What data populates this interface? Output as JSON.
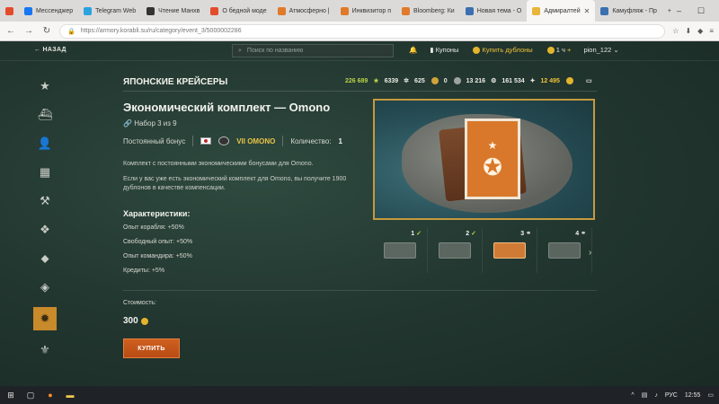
{
  "browser": {
    "tabs": [
      {
        "label": "Мессенджер",
        "color": "#1877f2"
      },
      {
        "label": "Telegram Web",
        "color": "#2aa3df"
      },
      {
        "label": "Чтение Манхв",
        "color": "#333333"
      },
      {
        "label": "О бедной моде",
        "color": "#e44b2a"
      },
      {
        "label": "Атмосферно |",
        "color": "#e07a2a"
      },
      {
        "label": "Инквизитор  п",
        "color": "#e07a2a"
      },
      {
        "label": "Bloomberg: Ки",
        "color": "#e07a2a"
      },
      {
        "label": "Новая тема - О",
        "color": "#3a6fb0"
      },
      {
        "label": "Адмиралтей",
        "color": "#e8b53a",
        "active": true
      },
      {
        "label": "Камуфляж - Пр",
        "color": "#3a6fb0"
      }
    ],
    "url": "https://armory.korabli.su/ru/category/event_3/5000002286"
  },
  "topbar": {
    "back_label": "НАЗАД",
    "search_placeholder": "Поиск по названию",
    "coupons_label": "Купоны",
    "buy_doubloons_label": "Купить дублоны",
    "timer": "1 ч",
    "username": "pion_122"
  },
  "category_title": "ЯПОНСКИЕ КРЕЙСЕРЫ",
  "resources": [
    {
      "value": "226 689",
      "kind": "free-xp",
      "color": "#b8d24a"
    },
    {
      "value": "6339",
      "kind": "elite-xp",
      "color": "#ecece6"
    },
    {
      "value": "625",
      "kind": "coal",
      "color": "#ecece6"
    },
    {
      "value": "0",
      "kind": "steel",
      "color": "#ecece6"
    },
    {
      "value": "13 216",
      "kind": "research",
      "color": "#ecece6"
    },
    {
      "value": "161 534",
      "kind": "credits",
      "color": "#ecece6"
    },
    {
      "value": "12 495",
      "kind": "doubloons",
      "color": "#f0c23a"
    }
  ],
  "product": {
    "title": "Экономический комплект — Omono",
    "set_info": "Набор 3 из 9",
    "bonus_type": "Постоянный бонус",
    "ship_tier": "VII OMONO",
    "quantity_label": "Количество:",
    "quantity_value": "1",
    "desc1": "Комплект с постоянными экономическими бонусами для Omono.",
    "desc2": "Если у вас уже есть экономический комплект для Omono, вы получите 1900 дублонов в качестве компенсации.",
    "chars_title": "Характеристики:",
    "characteristics": [
      "Опыт корабля: +50%",
      "Свободный опыт: +50%",
      "Опыт командира: +50%",
      "Кредиты: +5%"
    ],
    "cost_label": "Стоимость:",
    "cost_value": "300",
    "buy_label": "КУПИТЬ"
  },
  "set_items": [
    {
      "num": "1",
      "state": "owned"
    },
    {
      "num": "2",
      "state": "owned"
    },
    {
      "num": "3",
      "state": "current"
    },
    {
      "num": "4",
      "state": "linked"
    }
  ],
  "taskbar": {
    "lang": "РУС",
    "time": "12:55"
  }
}
